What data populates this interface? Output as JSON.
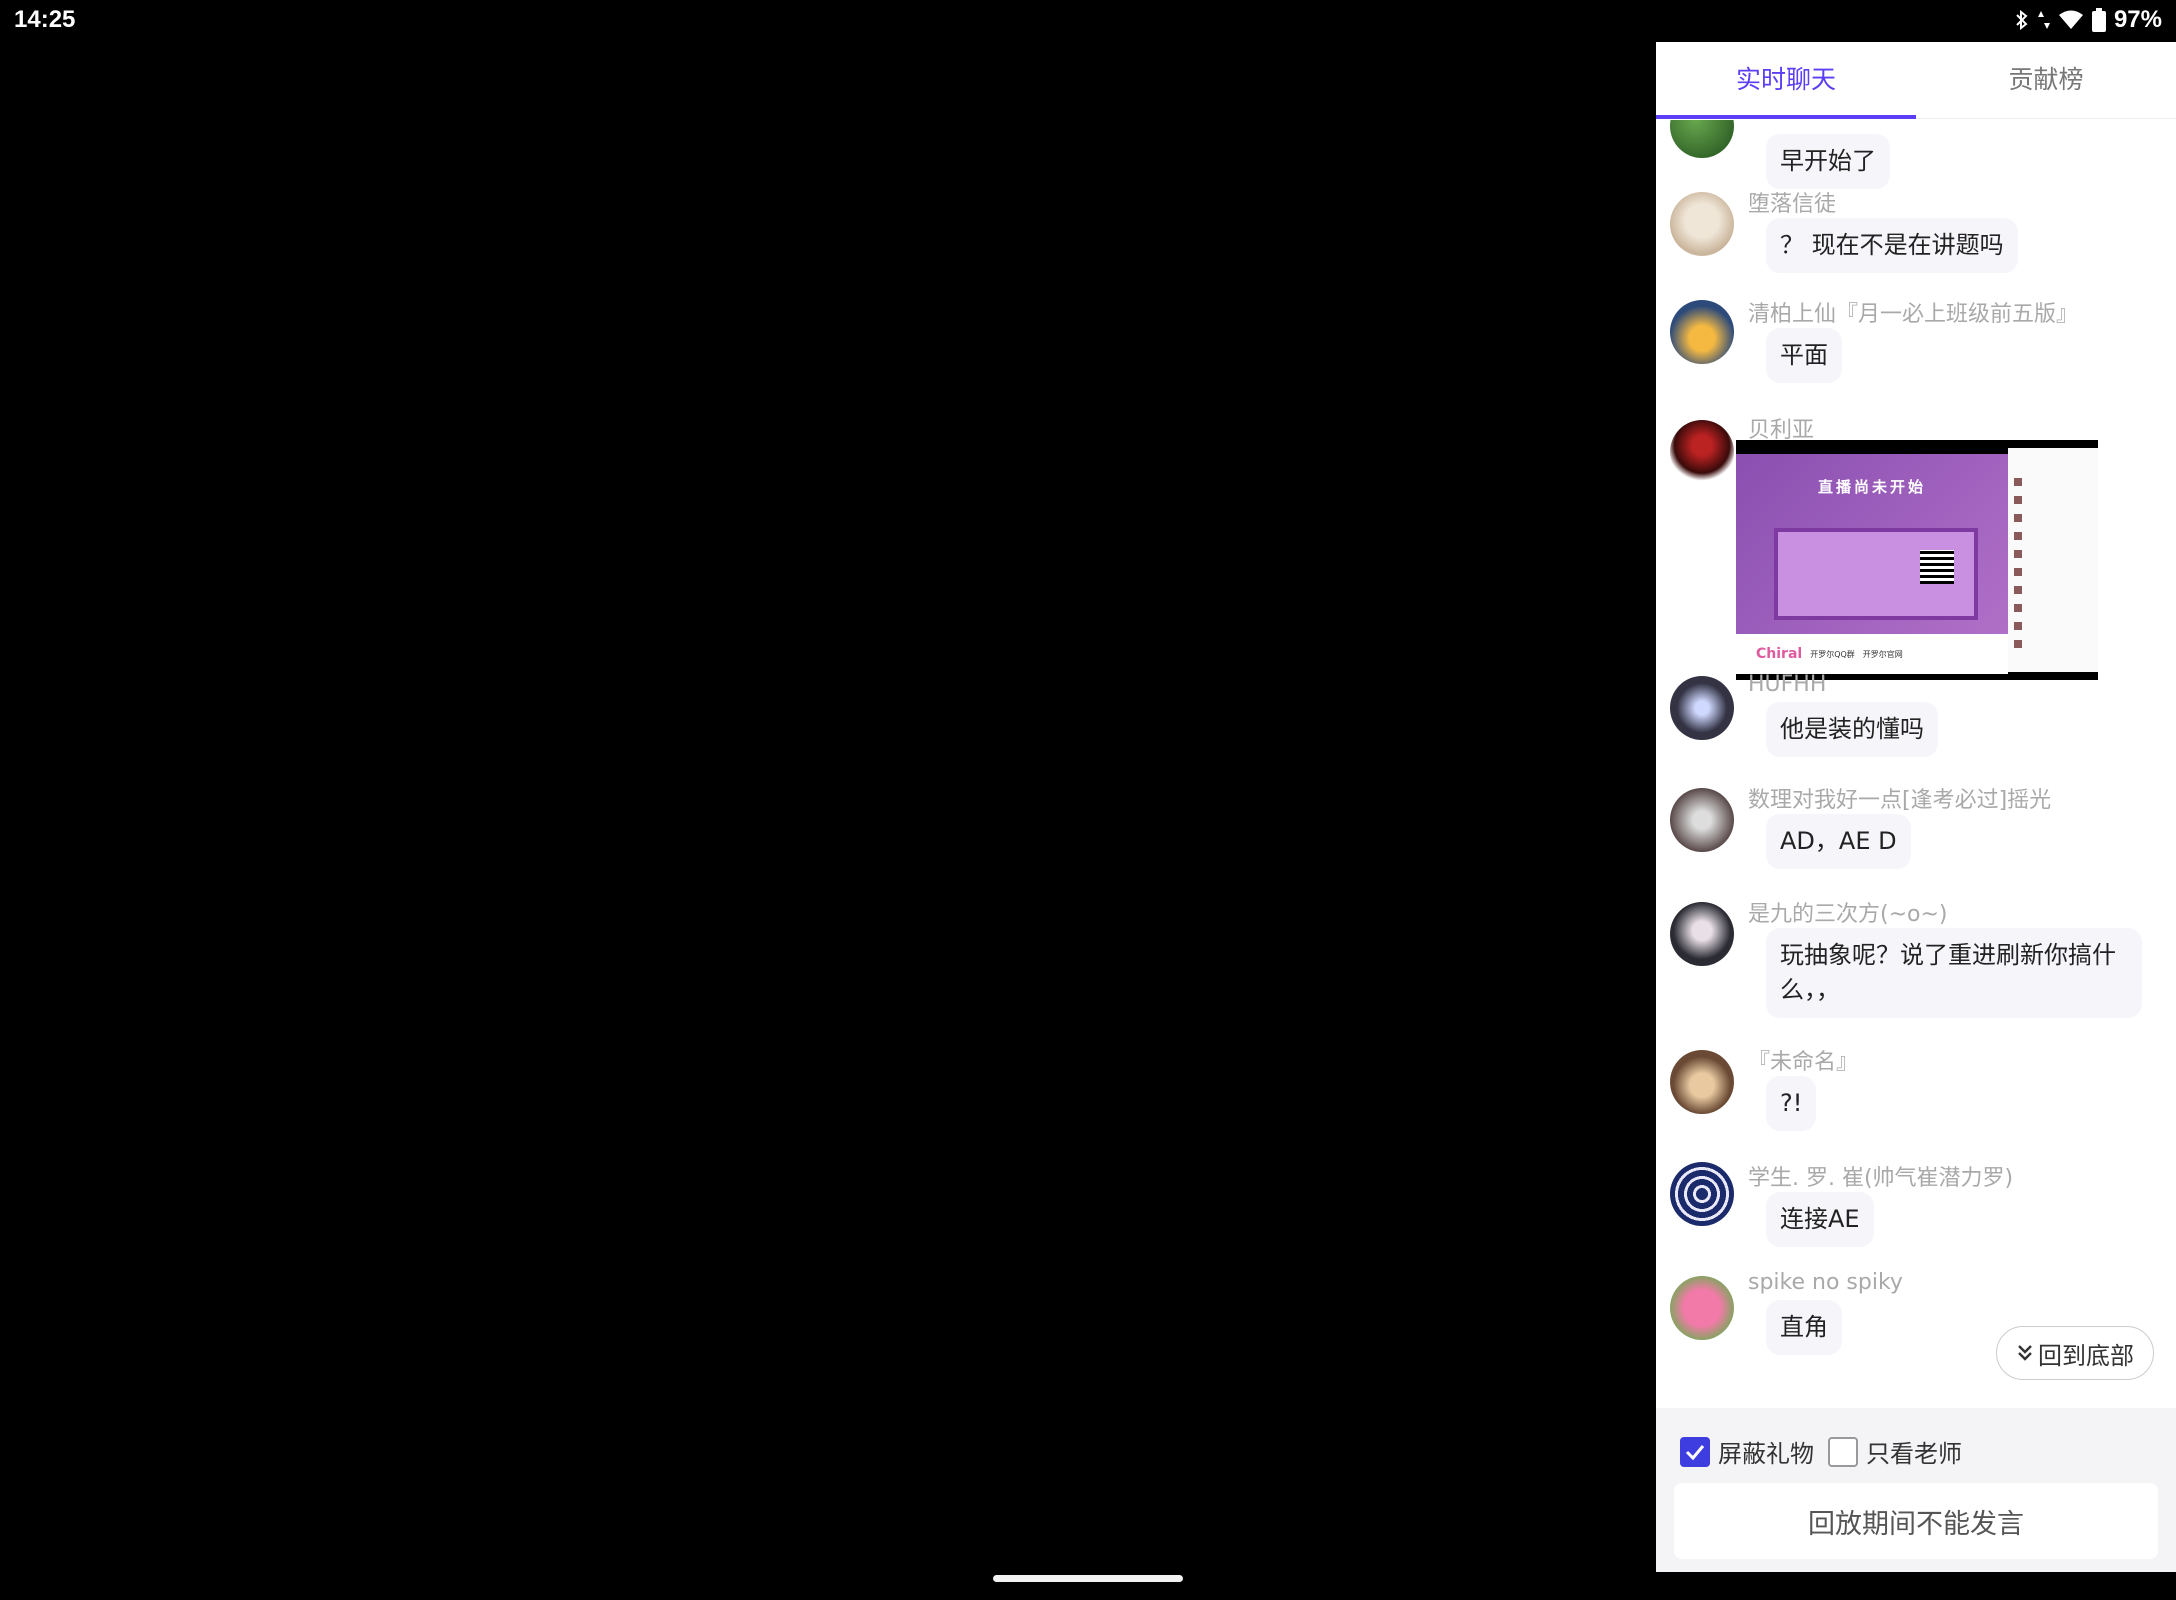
{
  "status_bar": {
    "time": "14:25",
    "battery": "97%",
    "icons": [
      "bluetooth-icon",
      "data-arrows-icon",
      "wifi-icon",
      "battery-icon"
    ]
  },
  "tabs": [
    {
      "label": "实时聊天",
      "active": true
    },
    {
      "label": "贡献榜",
      "active": false
    }
  ],
  "messages": [
    {
      "user": "",
      "text": "早开始了"
    },
    {
      "user": "堕落信徒",
      "text": "？ 现在不是在讲题吗"
    },
    {
      "user": "清柏上仙『月一必上班级前五版』",
      "text": "平面"
    },
    {
      "user": "贝利亚",
      "image": {
        "title": "直播尚未开始",
        "brand": "Chiral",
        "qr_caption": "开罗尔QQ群",
        "site_caption": "开罗尔官网"
      }
    },
    {
      "user": "HUFHH",
      "text": "他是装的懂吗"
    },
    {
      "user": "数理对我好一点[逢考必过]摇光",
      "text": "AD，AE D"
    },
    {
      "user": "是九的三次方(~o~)",
      "text": "玩抽象呢？说了重进刷新你搞什么，，"
    },
    {
      "user": "『未命名』",
      "text": "?!"
    },
    {
      "user": "学生. 罗. 崔(帅气崔潜力罗)",
      "text": "连接AE"
    },
    {
      "user": "spike no spiky",
      "text": "直角"
    }
  ],
  "back_to_bottom": "回到底部",
  "filters": {
    "block_gifts": {
      "label": "屏蔽礼物",
      "checked": true
    },
    "teacher_only": {
      "label": "只看老师",
      "checked": false
    }
  },
  "input": {
    "placeholder": "回放期间不能发言"
  },
  "colors": {
    "accent": "#5b3ef5",
    "checkbox": "#3d3de0"
  }
}
